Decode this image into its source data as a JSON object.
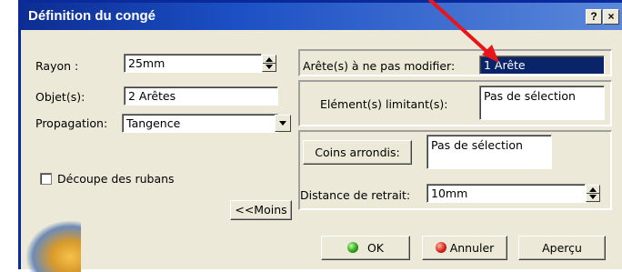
{
  "window": {
    "title": "Définition du congé",
    "help_button": "?",
    "close_button": "×"
  },
  "left": {
    "rayon_label": "Rayon :",
    "rayon_value": "25mm",
    "objets_label": "Objet(s):",
    "objets_value": "2 Arêtes",
    "propagation_label": "Propagation:",
    "propagation_value": "Tangence",
    "decoupe_label": "Découpe des rubans",
    "decoupe_checked": false,
    "moins_button": "<<Moins"
  },
  "right": {
    "aretes_label": "Arête(s) à ne pas modifier:",
    "aretes_value": "1 Arête",
    "elements_label": "Elément(s) limitant(s):",
    "elements_value": "Pas de sélection",
    "coins_button": "Coins arrondis:",
    "coins_value": "Pas de sélection",
    "distance_label": "Distance de retrait:",
    "distance_value": "10mm"
  },
  "buttons": {
    "ok": "OK",
    "annuler": "Annuler",
    "apercu": "Aperçu"
  },
  "colors": {
    "annotation_arrow": "#e8161b",
    "title_bar": "#1b4fc4",
    "selected_field": "#0a246a"
  },
  "icons": {
    "ok": "green-circle-icon",
    "annuler": "red-circle-icon"
  }
}
